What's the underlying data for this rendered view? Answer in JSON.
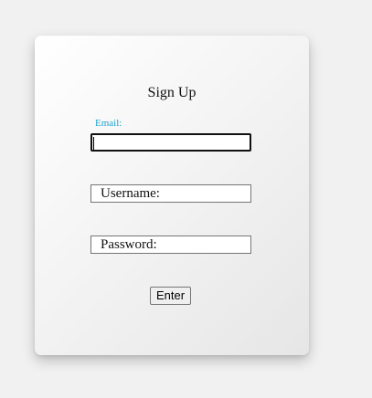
{
  "form": {
    "title": "Sign Up",
    "email": {
      "label": "Email:",
      "value": ""
    },
    "username": {
      "placeholder": "Username:"
    },
    "password": {
      "placeholder": "Password:"
    },
    "submit_label": "Enter"
  },
  "colors": {
    "background": "#f1f1f1",
    "label_accent": "#1aa3cf",
    "focus_border": "#101010"
  }
}
